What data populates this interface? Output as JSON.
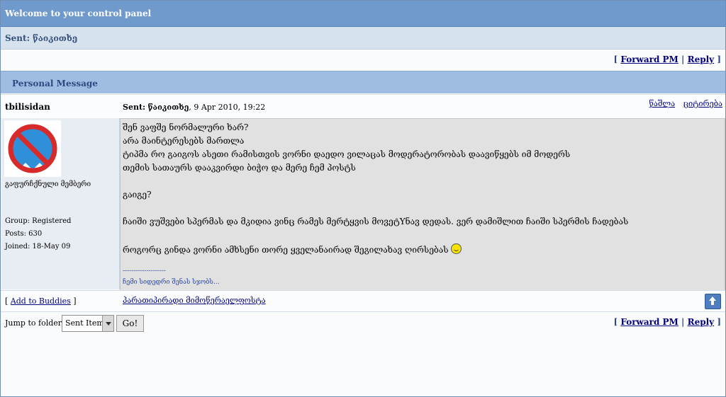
{
  "header": {
    "title": "Welcome to your control panel",
    "subtitle": "Sent: წაიკითხე"
  },
  "actions": {
    "forward": "Forward PM",
    "reply": "Reply",
    "open_bracket": "[",
    "separator": "|",
    "close_bracket": "]"
  },
  "message": {
    "section_label": "Personal Message",
    "author": "tbilisidan",
    "sent_label": "Sent:",
    "sent_subject": "წაიკითხე",
    "sent_date": ", 9 Apr 2010, 19:22",
    "delete": "წაშლა",
    "quote": "ციტირება",
    "member_group_label": "გაფურჩქნული მემბერი",
    "group": "Group: Registered",
    "posts": "Posts: 630",
    "joined": "Joined: 18-May 09",
    "lines": [
      "შენ ვაფშე ნორმალური ხარ?",
      "არა მაინტერესებს მართლა",
      "ტიპმა რო გაიგოს ასეთი რამისთვის ვორნი დაედო ვილაცას მოდერატორობას დაავიწყებს იმ მოდერს",
      "თემის სათაურს დააკვირდი ბიჭო და მერე ჩემ პოსტს",
      "გაიგე?",
      "ჩაიში ვუშვები სპერმას და მკიდია ვინც რამეს მერტყვის მოვეტYნავ დედას. ვერ დამიშლით ჩაიში სპერმის ჩადებას",
      "როგორც გინდა ვორნი ამხსენი თორე ყველანაირად შეგილახავ ღირსებას"
    ],
    "sig_divider": "--------------------",
    "signature": "ჩემი სიდედრი შენას სჯობს..."
  },
  "bottom": {
    "add_buddies": "Add to Buddies",
    "contact": "პარათიპირადი მიმოწერაელფოსტა",
    "jump_label": "Jump to folder:",
    "folder": "Sent Items",
    "go": "Go!"
  },
  "icons": {
    "avatar": "no-bavaria-avatar-icon",
    "smiley": "smiley-icon",
    "top": "up-arrow-icon"
  }
}
